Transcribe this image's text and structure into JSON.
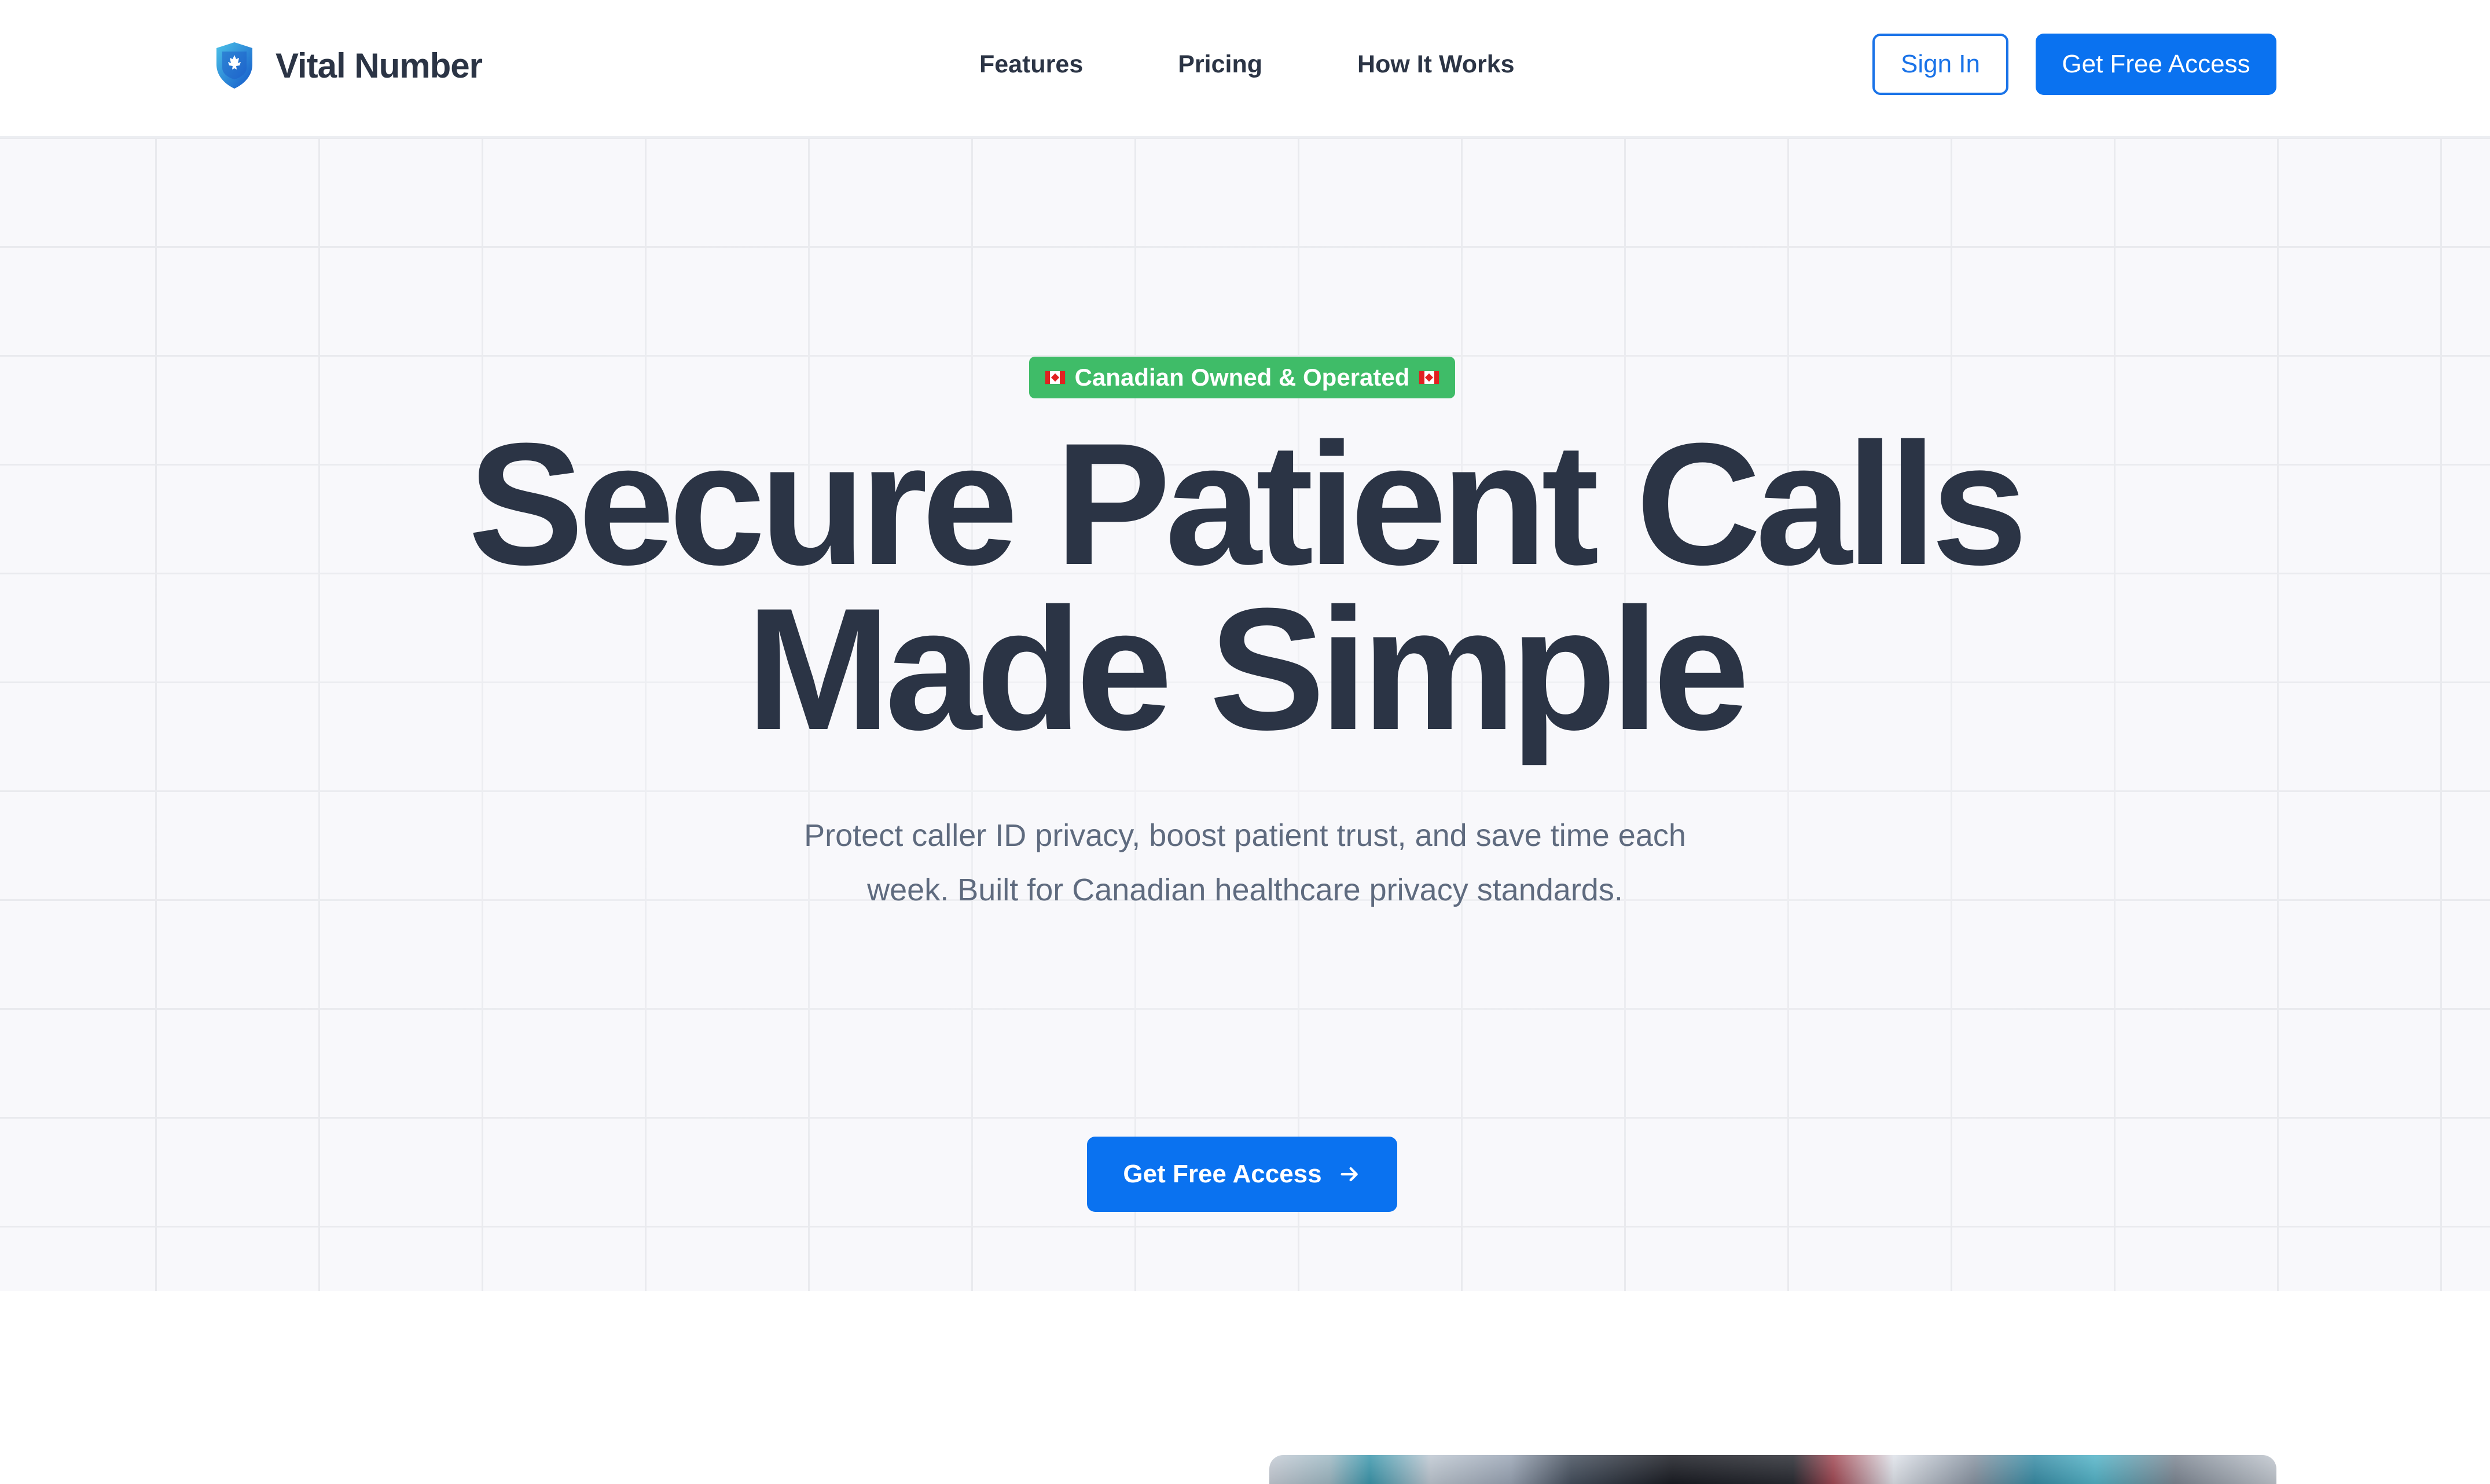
{
  "brand": {
    "name": "Vital Number",
    "logo_icon": "maple-leaf-shield-icon",
    "primary_color": "#0a72f0",
    "text_color": "#2b3445"
  },
  "nav": {
    "items": [
      {
        "label": "Features"
      },
      {
        "label": "Pricing"
      },
      {
        "label": "How It Works"
      }
    ]
  },
  "header": {
    "sign_in_label": "Sign In",
    "cta_label": "Get Free Access"
  },
  "hero": {
    "badge": {
      "text": "Canadian Owned & Operated",
      "icon": "canada-flag-icon",
      "color": "#3fbc68"
    },
    "headline_line1": "Secure Patient Calls",
    "headline_line2": "Made Simple",
    "subtext_line1": "Protect caller ID privacy, boost patient trust, and save time each",
    "subtext_line2": "week. Built for Canadian healthcare privacy standards.",
    "cta_label": "Get Free Access",
    "cta_icon": "arrow-right-icon"
  }
}
